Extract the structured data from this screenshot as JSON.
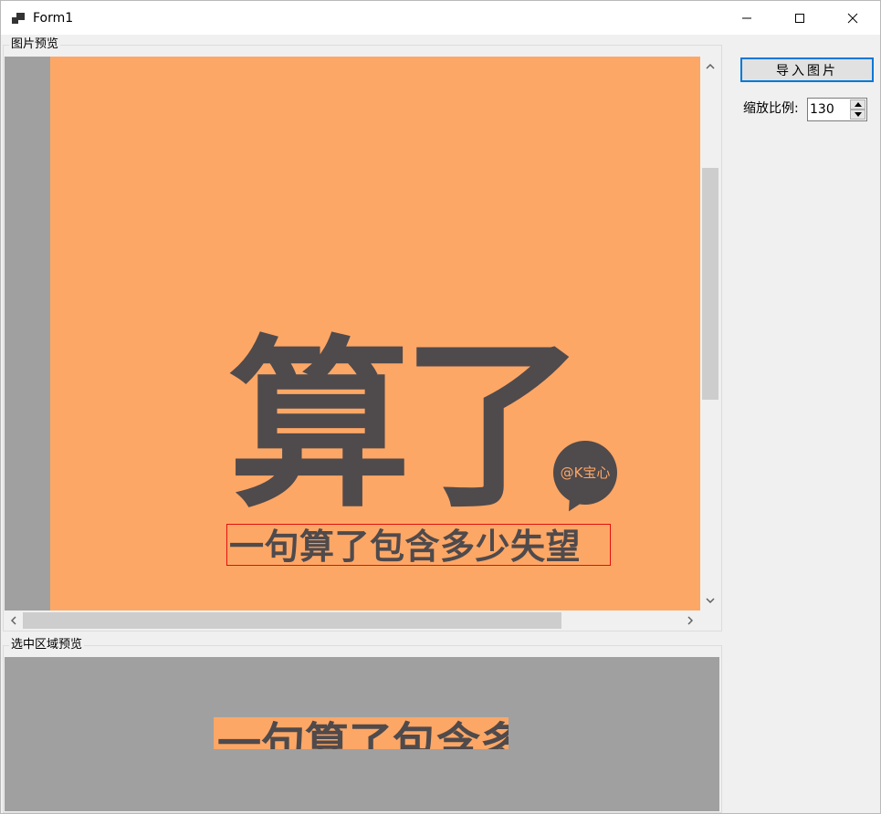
{
  "window": {
    "title": "Form1"
  },
  "image_preview": {
    "caption": "图片预览",
    "image_title": "算了",
    "image_subtitle": "一句算了包含多少失望",
    "watermark": "@K宝心"
  },
  "selection_preview": {
    "caption": "选中区域预览",
    "crop_text": "一句算了包含多少失望"
  },
  "controls": {
    "import_label": "导入图片",
    "scale_label": "缩放比例:",
    "scale_value": "130"
  },
  "colors": {
    "image_bg": "#fda766",
    "image_text": "#4f4a4c",
    "viewer_bg": "#a0a0a0",
    "selection": "#e01010",
    "accent": "#0078d7"
  }
}
